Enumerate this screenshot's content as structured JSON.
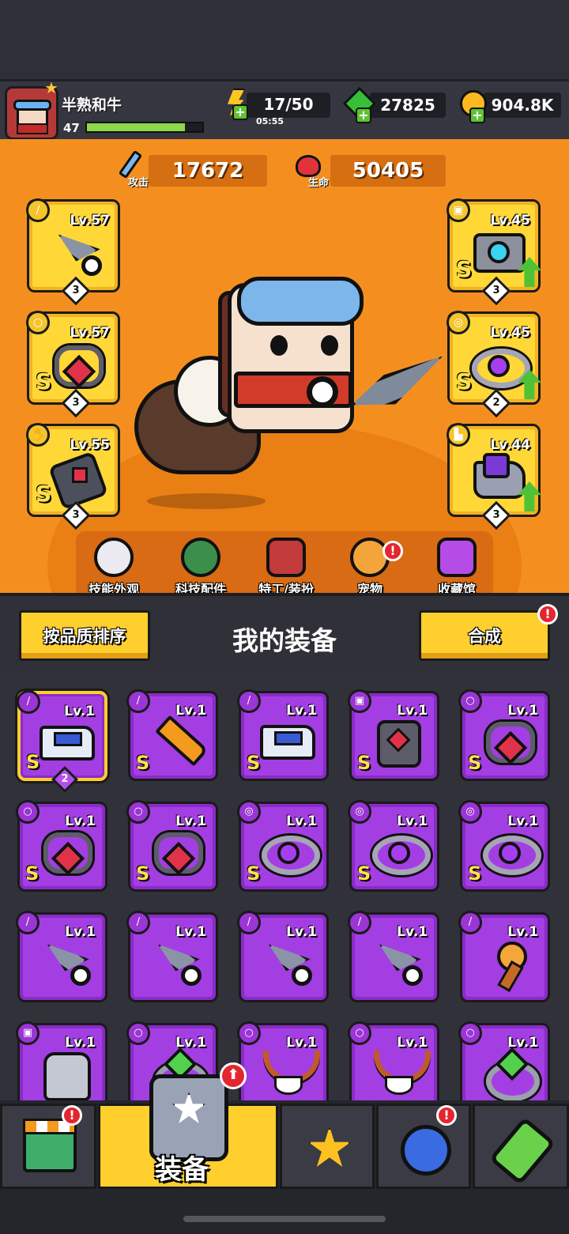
{
  "header": {
    "player_name": "半熟和牛",
    "player_level": "47",
    "xp_progress": 0.85,
    "energy": "17/50",
    "energy_timer": "05:55",
    "gems": "27825",
    "gold": "904.8K"
  },
  "stats": {
    "attack_label": "攻击",
    "attack_value": "17672",
    "hp_label": "生命",
    "hp_value": "50405"
  },
  "equipped": {
    "weapon": {
      "level": "Lv.57",
      "grade": "",
      "stars": "3",
      "icon": "kunai-icon",
      "slot_icon": "sword-slot-icon"
    },
    "necklace": {
      "level": "Lv.57",
      "grade": "S",
      "stars": "3",
      "icon": "chain-necklace-icon",
      "slot_icon": "necklace-slot-icon"
    },
    "gloves": {
      "level": "Lv.55",
      "grade": "S",
      "stars": "3",
      "icon": "gauntlet-icon",
      "slot_icon": "glove-slot-icon"
    },
    "armor": {
      "level": "Lv.45",
      "grade": "S",
      "stars": "3",
      "icon": "mech-armor-icon",
      "slot_icon": "armor-slot-icon"
    },
    "belt": {
      "level": "Lv.45",
      "grade": "S",
      "stars": "2",
      "icon": "belt-icon",
      "slot_icon": "belt-slot-icon"
    },
    "boots": {
      "level": "Lv.44",
      "grade": "",
      "stars": "3",
      "icon": "boot-icon",
      "slot_icon": "boot-slot-icon"
    }
  },
  "mid_nav": {
    "skills": "技能外观",
    "tech": "科技配件",
    "agent": "特工/装扮",
    "pet": "宠物",
    "collection": "收藏馆"
  },
  "inventory": {
    "sort_label": "按品质排序",
    "title": "我的装备",
    "merge_label": "合成",
    "items": [
      {
        "level": "Lv.1",
        "grade": "S",
        "art": "gun",
        "count": "2"
      },
      {
        "level": "Lv.1",
        "grade": "S",
        "art": "sword"
      },
      {
        "level": "Lv.1",
        "grade": "S",
        "art": "gun"
      },
      {
        "level": "Lv.1",
        "grade": "S",
        "art": "armor"
      },
      {
        "level": "Lv.1",
        "grade": "S",
        "art": "chain"
      },
      {
        "level": "Lv.1",
        "grade": "S",
        "art": "chain"
      },
      {
        "level": "Lv.1",
        "grade": "S",
        "art": "chain"
      },
      {
        "level": "Lv.1",
        "grade": "S",
        "art": "belt"
      },
      {
        "level": "Lv.1",
        "grade": "S",
        "art": "belt"
      },
      {
        "level": "Lv.1",
        "grade": "S",
        "art": "belt"
      },
      {
        "level": "Lv.1",
        "grade": "",
        "art": "kunai"
      },
      {
        "level": "Lv.1",
        "grade": "",
        "art": "kunai"
      },
      {
        "level": "Lv.1",
        "grade": "",
        "art": "kunai"
      },
      {
        "level": "Lv.1",
        "grade": "",
        "art": "kunai"
      },
      {
        "level": "Lv.1",
        "grade": "",
        "art": "torch"
      },
      {
        "level": "Lv.1",
        "grade": "",
        "art": "plate"
      },
      {
        "level": "Lv.1",
        "grade": "",
        "art": "ring"
      },
      {
        "level": "Lv.1",
        "grade": "",
        "art": "necklace"
      },
      {
        "level": "Lv.1",
        "grade": "",
        "art": "necklace"
      },
      {
        "level": "Lv.1",
        "grade": "",
        "art": "ring"
      }
    ]
  },
  "bottom_nav": {
    "active_label": "装备"
  },
  "badges": {
    "alert": "!",
    "upgrade": "⬆"
  }
}
